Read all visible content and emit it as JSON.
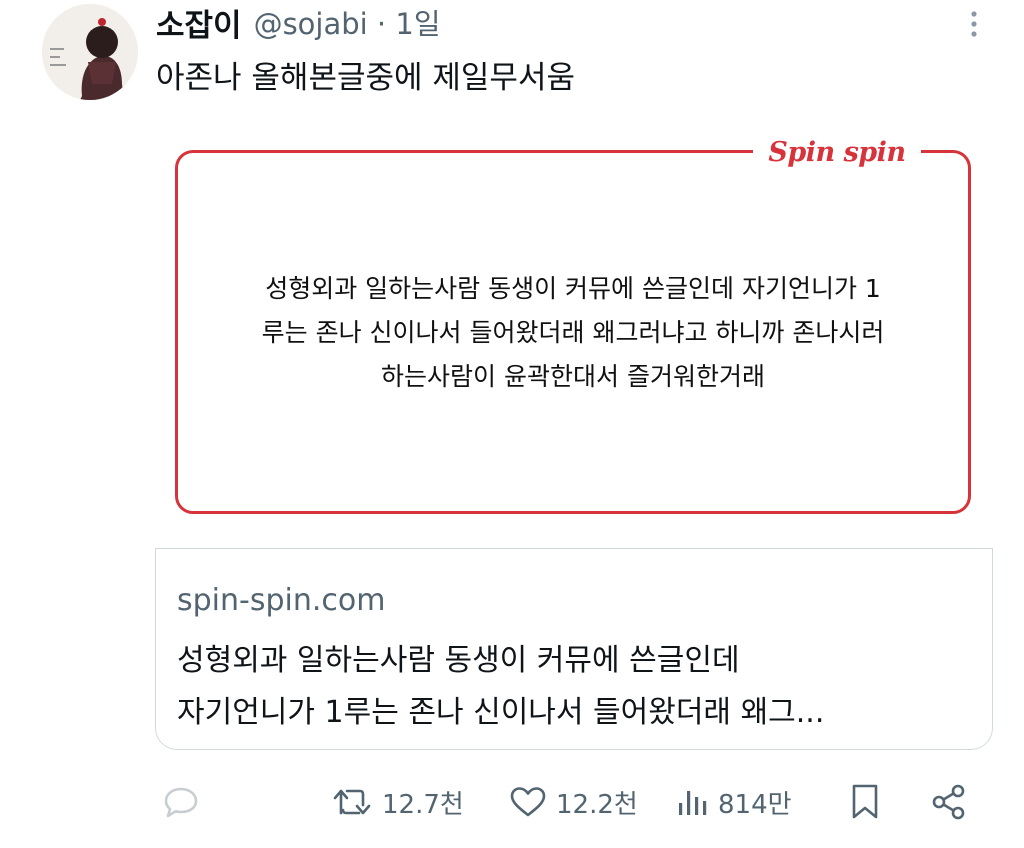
{
  "tweet": {
    "author_name": "소잡이",
    "handle_time": "@sojabi · 1일",
    "text": "아존나 올해본글중에 제일무서움"
  },
  "card": {
    "logo_text": "Spin spin",
    "image_lines": [
      "성형외과 일하는사람 동생이 커뮤에 쓴글인데 자기언니가 1",
      "루는 존나 신이나서 들어왔더래 왜그러냐고 하니까 존나시러",
      "하는사람이 윤곽한대서 즐거워한거래"
    ],
    "domain": "spin-spin.com",
    "title_lines": [
      "성형외과 일하는사람 동생이 커뮤에 쓴글인데",
      "자기언니가 1루는 존나 신이나서 들어왔더래 왜그..."
    ]
  },
  "actions": {
    "retweets": "12.7천",
    "likes": "12.2천",
    "views": "814만"
  },
  "colors": {
    "accent_red": "#d6333b",
    "secondary_text": "#536471",
    "icon_gray": "#c8cdd2"
  },
  "icons": [
    "more-vertical-icon",
    "reply-icon",
    "retweet-icon",
    "heart-icon",
    "views-icon",
    "bookmark-icon",
    "share-icon"
  ]
}
